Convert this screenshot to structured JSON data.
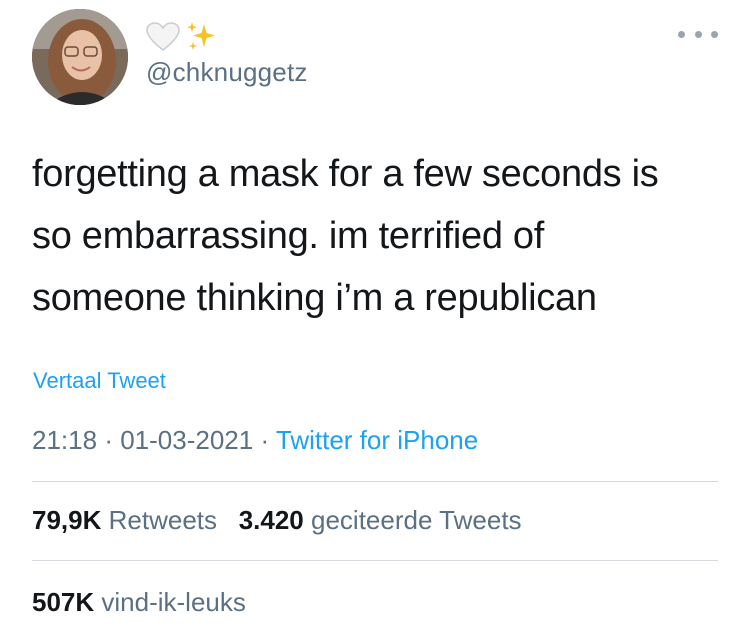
{
  "user": {
    "display_name_emoji": "🤍✨",
    "handle": "@chknuggetz"
  },
  "icons": {
    "more": "more-options-icon",
    "heart": "white-heart-icon",
    "sparkles": "sparkles-icon"
  },
  "tweet": {
    "lines": [
      "forgetting a mask for a few seconds is",
      "so embarrassing. im terrified of",
      "someone thinking i’m a republican"
    ],
    "translate_label": "Vertaal Tweet",
    "time": "21:18",
    "date": "01-03-2021",
    "separator": "·",
    "source": "Twitter for iPhone"
  },
  "stats": {
    "retweets_count": "79,9K",
    "retweets_label": "Retweets",
    "quotes_count": "3.420",
    "quotes_label": "geciteerde Tweets",
    "likes_count": "507K",
    "likes_label": "vind-ik-leuks"
  },
  "colors": {
    "link": "#1da1f2",
    "secondary": "#5b7083",
    "primary": "#14171a",
    "divider": "#d6dbe0"
  }
}
